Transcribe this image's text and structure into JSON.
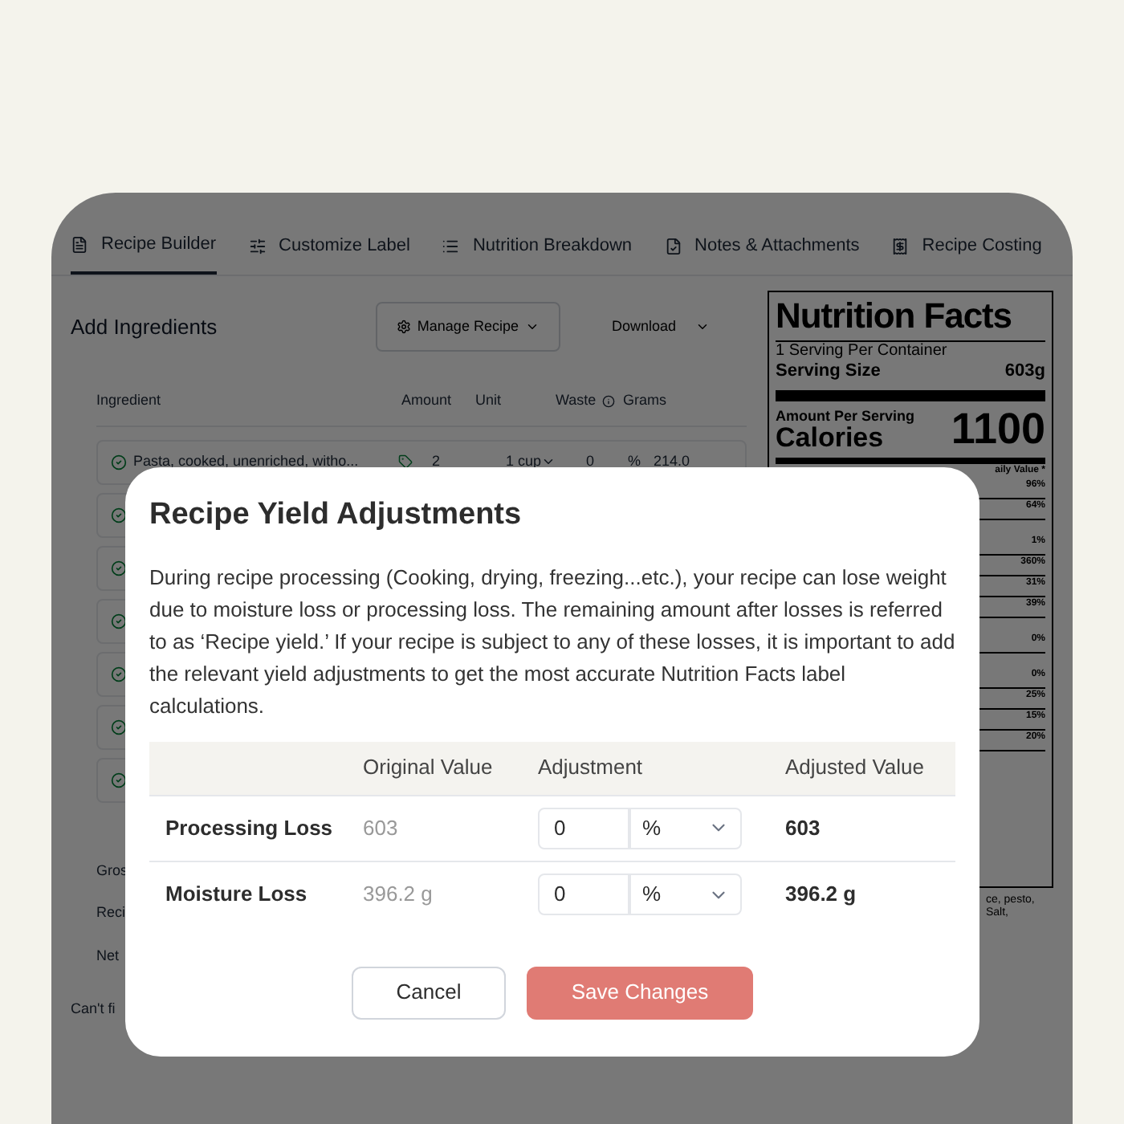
{
  "tabs": [
    {
      "label": "Recipe Builder",
      "selected": true
    },
    {
      "label": "Customize Label",
      "selected": false
    },
    {
      "label": "Nutrition Breakdown",
      "selected": false
    },
    {
      "label": "Notes & Attachments",
      "selected": false
    },
    {
      "label": "Recipe Costing",
      "selected": false
    }
  ],
  "builder": {
    "title": "Add Ingredients",
    "manage_button": "Manage Recipe",
    "download_button": "Download",
    "columns": [
      "Ingredient",
      "Amount",
      "Unit",
      "Waste",
      "Grams"
    ],
    "rows": [
      {
        "ingredient": "Pasta, cooked, unenriched, witho...",
        "amount": "2",
        "unit": "1 cup",
        "waste": "0",
        "waste_unit": "%",
        "grams": "214.0"
      }
    ],
    "footer": [
      "Gros",
      "Reci",
      "Net"
    ],
    "note": "Can't fi"
  },
  "label": {
    "title": "Nutrition Facts",
    "servings": "1 Serving Per Container",
    "serving_size_label": "Serving Size",
    "serving_size": "603g",
    "amount_per_serving": "Amount Per Serving",
    "calories_label": "Calories",
    "calories": "1100",
    "dv_header": "aily Value *",
    "percents": [
      "96%",
      "64%",
      "1%",
      "360%",
      "31%",
      "39%",
      "0%",
      "0%",
      "25%",
      "15%",
      "20%"
    ],
    "ingredients_fragments": [
      "ce, pesto,",
      "Salt,"
    ]
  },
  "dialog": {
    "title": "Recipe Yield Adjustments",
    "body": "During recipe processing (Cooking, drying, freezing...etc.), your recipe can lose weight due to moisture loss or processing loss. The remaining amount after losses is referred to as ‘Recipe yield.’ If your recipe is subject to any of these losses, it is important to add the relevant yield adjustments to get the most accurate Nutrition Facts label calculations.",
    "columns": [
      "Original Value",
      "Adjustment",
      "Adjusted Value"
    ],
    "rows": [
      {
        "name": "Processing Loss",
        "original": "603",
        "adjustment": "0",
        "unit": "%",
        "adjusted": "603"
      },
      {
        "name": "Moisture Loss",
        "original": "396.2 g",
        "adjustment": "0",
        "unit": "%",
        "adjusted": "396.2 g"
      }
    ],
    "cancel": "Cancel",
    "save": "Save Changes"
  }
}
